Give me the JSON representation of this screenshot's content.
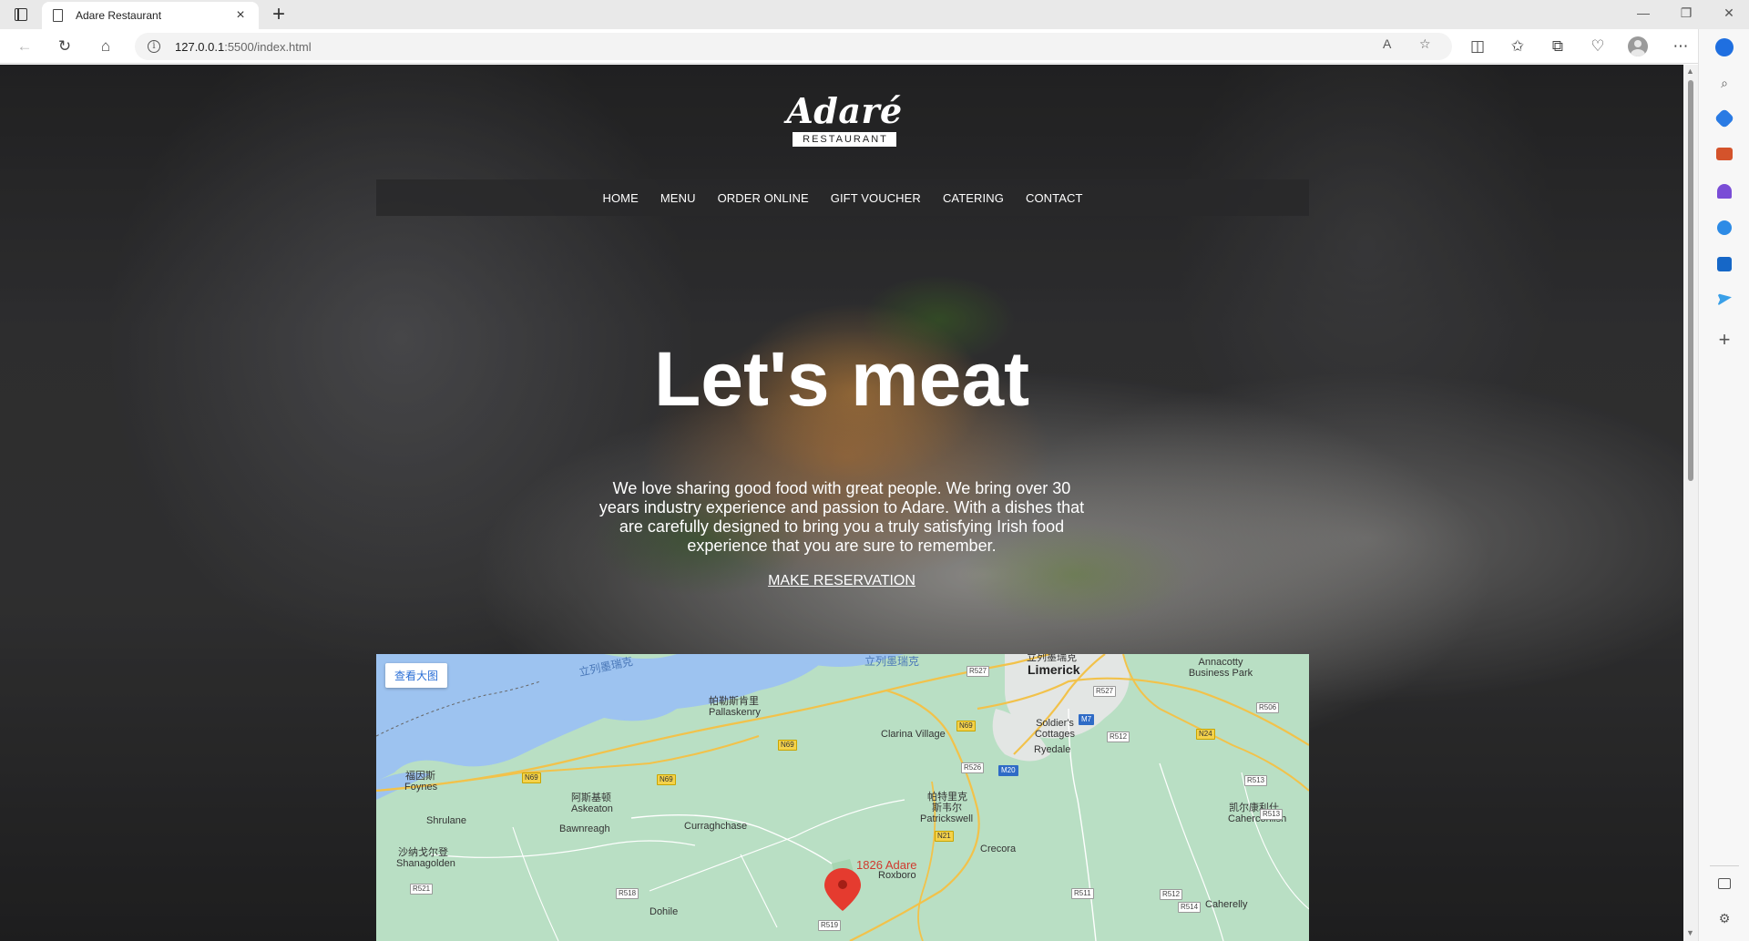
{
  "browser": {
    "tab_title": "Adare Restaurant",
    "tab_close": "×",
    "new_tab": "+",
    "url_host": "127.0.0.1",
    "url_rest": ":5500/index.html",
    "window_controls": {
      "minimize": "—",
      "restore": "❐",
      "close": "✕"
    },
    "toolbar_icons": [
      "back-icon",
      "refresh-icon",
      "home-icon",
      "read-aloud-icon",
      "favorite-icon",
      "split-screen-icon",
      "favorites-icon",
      "collections-icon",
      "performance-icon",
      "profile-icon",
      "more-icon"
    ],
    "sidebar_icons": [
      "search-icon",
      "shopping-icon",
      "tools-icon",
      "games-icon",
      "office-icon",
      "outlook-icon",
      "send-icon",
      "add-icon",
      "sidebar-toggle-icon",
      "settings-icon"
    ]
  },
  "site": {
    "logo_script": "Adaré",
    "logo_sub": "RESTAURANT",
    "nav": [
      "HOME",
      "MENU",
      "ORDER ONLINE",
      "GIFT VOUCHER",
      "CATERING",
      "CONTACT"
    ],
    "headline": "Let's meat",
    "intro": "We love sharing good food with great people. We bring over 30 years industry experience and passion to Adare. With a dishes that are carefully designed to bring you a truly satisfying Irish food experience that you are sure to remember.",
    "reservation_link": "MAKE RESERVATION"
  },
  "map": {
    "view_larger": "查看大图",
    "pin_label": "1826 Adare",
    "places": [
      {
        "cn": "立列墨瑞克",
        "en": "Limerick"
      },
      {
        "cn": "",
        "en": "Annacotty Business Park"
      },
      {
        "cn": "帕勒斯肯里",
        "en": "Pallaskenry"
      },
      {
        "cn": "",
        "en": "Clarina Village"
      },
      {
        "cn": "",
        "en": "Soldier's Cottages"
      },
      {
        "cn": "",
        "en": "Ryedale"
      },
      {
        "cn": "福因斯",
        "en": "Foynes"
      },
      {
        "cn": "阿斯基顿",
        "en": "Askeaton"
      },
      {
        "cn": "",
        "en": "Shrulane"
      },
      {
        "cn": "",
        "en": "Bawnreagh"
      },
      {
        "cn": "",
        "en": "Curraghchase"
      },
      {
        "cn": "帕特里克",
        "en": ""
      },
      {
        "cn": "斯韦尔",
        "en": "Patrickswell"
      },
      {
        "cn": "凯尔康利什",
        "en": "Caherconlish"
      },
      {
        "cn": "沙纳戈尔登",
        "en": "Shanagolden"
      },
      {
        "cn": "",
        "en": "Crecora"
      },
      {
        "cn": "",
        "en": "Roxboro"
      },
      {
        "cn": "",
        "en": "Dohile"
      },
      {
        "cn": "",
        "en": "Caherelly"
      }
    ],
    "water_labels": [
      "立列墨瑞克",
      "立列墨瑞克"
    ],
    "roads": [
      "R527",
      "R527",
      "R506",
      "N69",
      "M7",
      "R512",
      "N24",
      "R526",
      "M20",
      "N69",
      "N69",
      "N69",
      "R513",
      "R513",
      "N21",
      "R521",
      "R518",
      "R511",
      "R512",
      "R514",
      "R519"
    ]
  }
}
